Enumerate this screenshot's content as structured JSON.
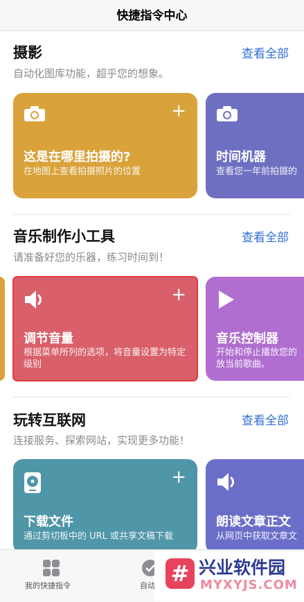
{
  "header": {
    "title": "快捷指令中心"
  },
  "sections": [
    {
      "title": "摄影",
      "subtitle": "自动化图库功能，超乎您的想象。",
      "see_all": "查看全部",
      "cards": [
        {
          "title": "这是在哪里拍摄的?",
          "desc": "在地图上查看拍摄照片的位置",
          "icon": "camera-icon",
          "color": "#d9a23a"
        },
        {
          "title": "时间机器",
          "desc": "查看您一年前拍摄的",
          "icon": "camera-icon",
          "color": "#6f6fc2"
        }
      ]
    },
    {
      "title": "音乐制作小工具",
      "subtitle": "请准备好您的乐器，练习时间到！",
      "see_all": "查看全部",
      "cards": [
        {
          "title": "调节音量",
          "desc": "根据菜单所列的选项，将音量设置为特定级别",
          "icon": "speaker-icon",
          "color": "#d9606a"
        },
        {
          "title": "音乐控制器",
          "desc": "开始和停止播放您的放当前歌曲。",
          "icon": "play-icon",
          "color": "#b06ed0"
        }
      ]
    },
    {
      "title": "玩转互联网",
      "subtitle": "连接服务、探索网站，实现更多功能！",
      "see_all": "查看全部",
      "cards": [
        {
          "title": "下载文件",
          "desc": "通过剪切板中的 URL 或共享文稿下载",
          "icon": "disk-icon",
          "color": "#4f96a8"
        },
        {
          "title": "朗读文章正文",
          "desc": "从网页中获取文章文",
          "icon": "speaker-icon",
          "color": "#6b6ec9"
        }
      ]
    }
  ],
  "tabbar": {
    "items": [
      {
        "label": "我的快捷指令",
        "icon": "grid-icon"
      },
      {
        "label": "自动",
        "icon": "check-circle-icon"
      }
    ]
  },
  "watermark": {
    "text": "兴业软件园",
    "url": "MYXYJS.COM",
    "logo": "#"
  }
}
